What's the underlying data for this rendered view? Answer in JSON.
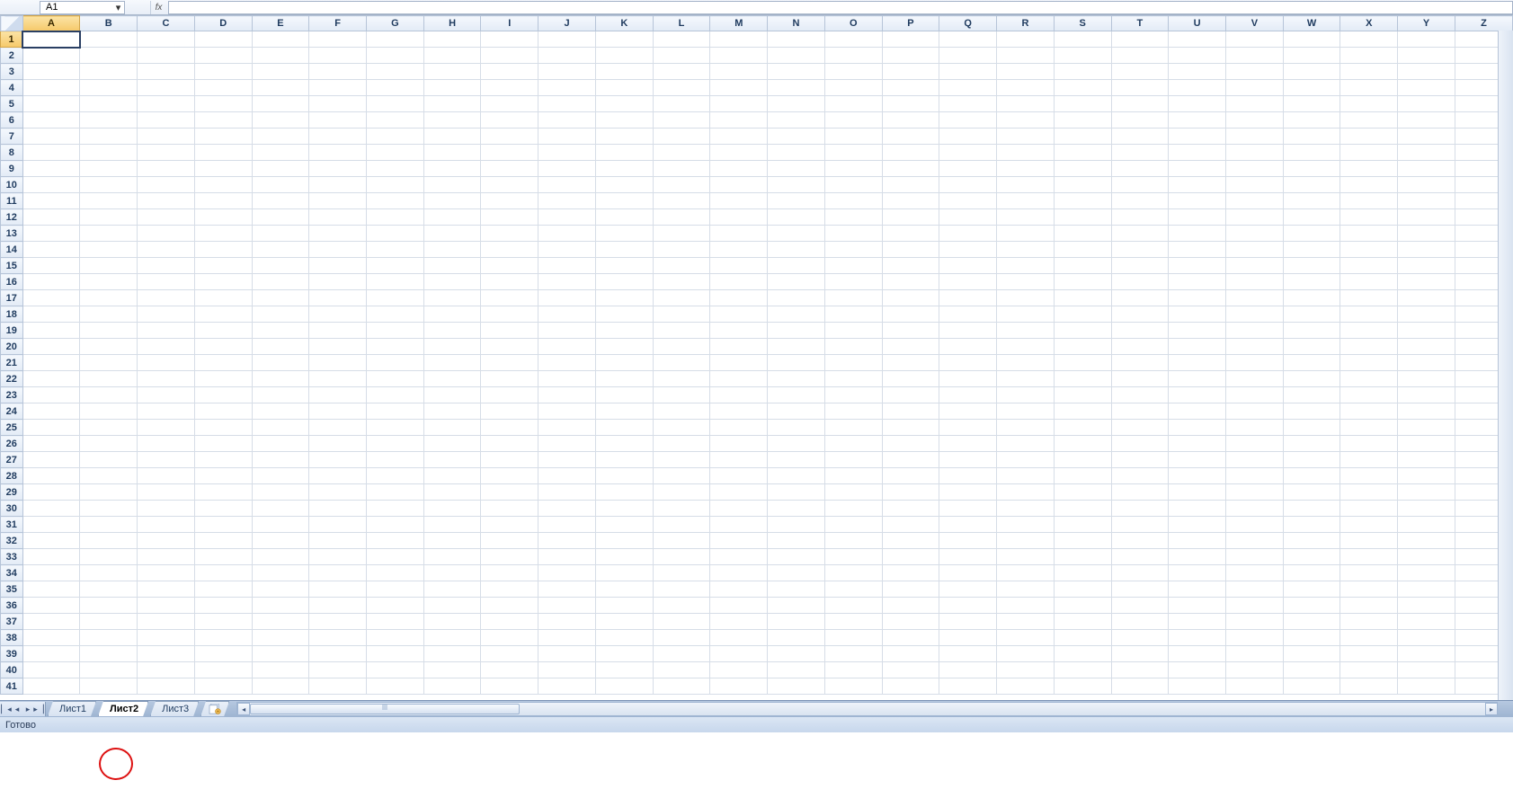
{
  "formulaBar": {
    "nameBox": "A1",
    "fxLabel": "fx",
    "formula": ""
  },
  "grid": {
    "columns": [
      "A",
      "B",
      "C",
      "D",
      "E",
      "F",
      "G",
      "H",
      "I",
      "J",
      "K",
      "L",
      "M",
      "N",
      "O",
      "P",
      "Q",
      "R",
      "S",
      "T",
      "U",
      "V",
      "W",
      "X",
      "Y",
      "Z"
    ],
    "activeColumn": "A",
    "rowCount": 41,
    "activeRow": 1,
    "activeCell": "A1"
  },
  "tabs": {
    "items": [
      {
        "label": "Лист1",
        "active": false
      },
      {
        "label": "Лист2",
        "active": true
      },
      {
        "label": "Лист3",
        "active": false
      }
    ],
    "newSheetTooltip": "Insert Worksheet"
  },
  "status": {
    "text": "Готово"
  },
  "annotation": {
    "target": "Лист2"
  }
}
